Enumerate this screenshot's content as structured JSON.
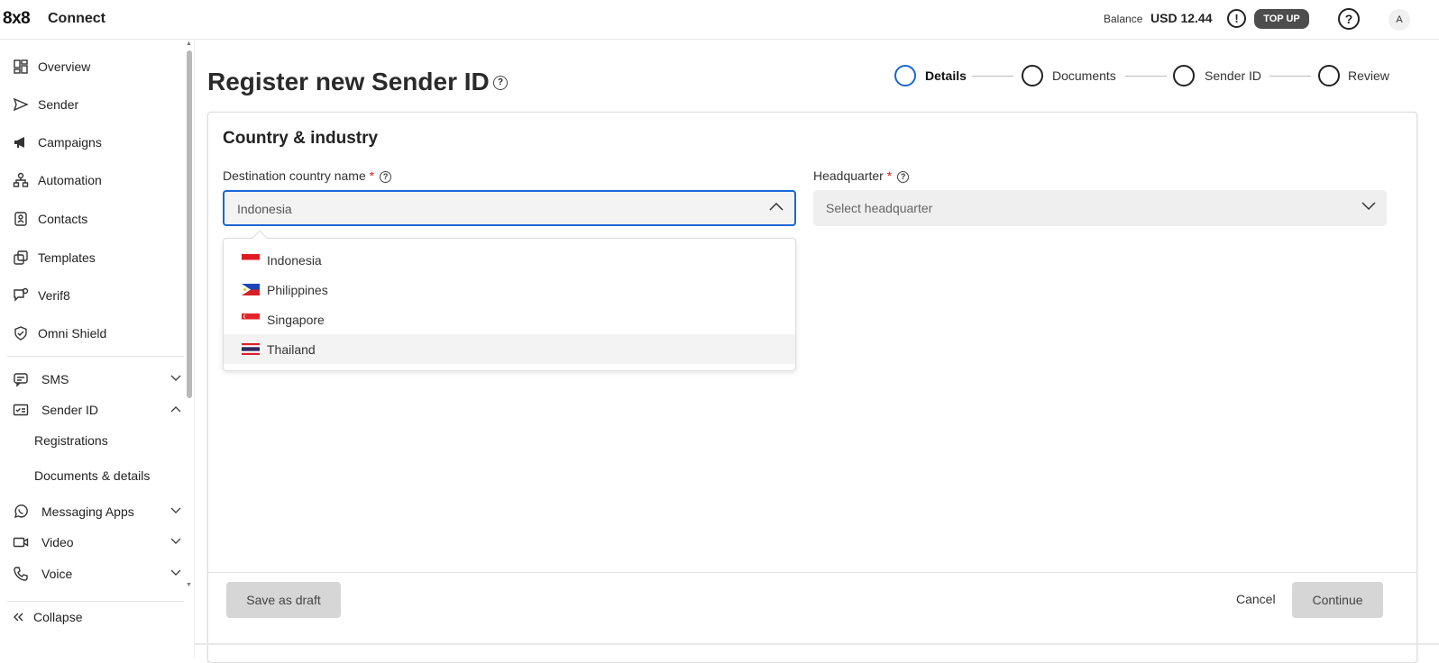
{
  "header": {
    "logo": "8x8",
    "app_name": "Connect",
    "balance_label": "Balance",
    "balance_value": "USD 12.44",
    "alert_glyph": "!",
    "topup_label": "TOP UP",
    "help_glyph": "?",
    "avatar_initial": "A"
  },
  "sidebar": {
    "items": [
      {
        "label": "Overview",
        "icon": "overview-icon"
      },
      {
        "label": "Sender",
        "icon": "send-icon"
      },
      {
        "label": "Campaigns",
        "icon": "megaphone-icon"
      },
      {
        "label": "Automation",
        "icon": "automation-icon"
      },
      {
        "label": "Contacts",
        "icon": "contacts-icon"
      },
      {
        "label": "Templates",
        "icon": "templates-icon"
      },
      {
        "label": "Verif8",
        "icon": "verify-icon"
      },
      {
        "label": "Omni Shield",
        "icon": "shield-icon"
      }
    ],
    "groups": [
      {
        "label": "SMS",
        "icon": "chat-icon",
        "expanded": false
      },
      {
        "label": "Sender ID",
        "icon": "id-card-icon",
        "expanded": true
      },
      {
        "label": "Messaging Apps",
        "icon": "whatsapp-icon",
        "expanded": false
      },
      {
        "label": "Video",
        "icon": "video-icon",
        "expanded": false
      },
      {
        "label": "Voice",
        "icon": "phone-icon",
        "expanded": false
      }
    ],
    "sender_id_sub": [
      "Registrations",
      "Documents & details"
    ],
    "collapse_label": "Collapse"
  },
  "page": {
    "title": "Register new Sender ID",
    "steps": [
      {
        "label": "Details",
        "active": true
      },
      {
        "label": "Documents",
        "active": false
      },
      {
        "label": "Sender ID",
        "active": false
      },
      {
        "label": "Review",
        "active": false
      }
    ],
    "section_title": "Country & industry",
    "country_field": {
      "label": "Destination country name",
      "required_mark": "*",
      "value": "Indonesia"
    },
    "hq_field": {
      "label": "Headquarter",
      "required_mark": "*",
      "placeholder": "Select headquarter"
    },
    "country_options": [
      {
        "label": "Indonesia",
        "flag": "flag-indonesia"
      },
      {
        "label": "Philippines",
        "flag": "flag-philippines"
      },
      {
        "label": "Singapore",
        "flag": "flag-singapore"
      },
      {
        "label": "Thailand",
        "flag": "flag-thailand"
      }
    ],
    "save_draft_label": "Save as draft",
    "cancel_label": "Cancel",
    "continue_label": "Continue"
  },
  "colors": {
    "accent": "#1a66d6",
    "required": "#d42020",
    "topup_bg": "#4d4d4d"
  }
}
